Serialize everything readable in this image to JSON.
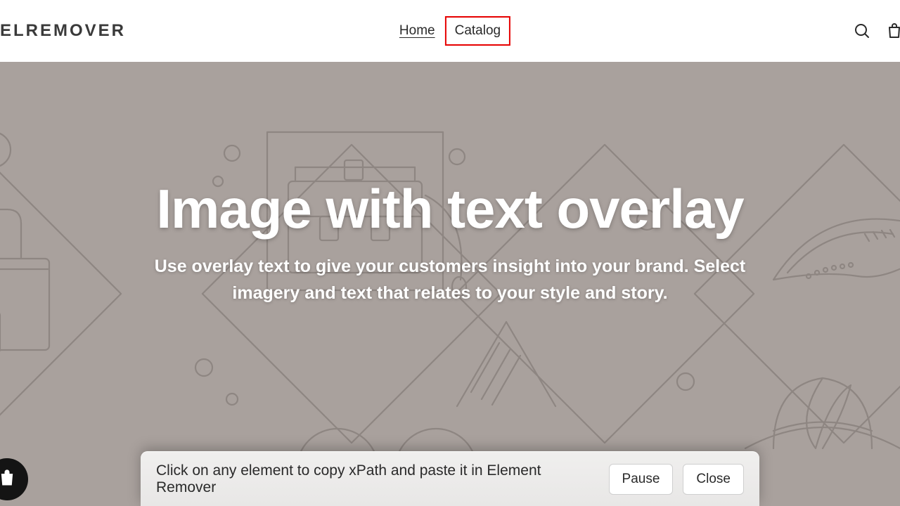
{
  "header": {
    "logo": "ELREMOVER",
    "nav": {
      "home": "Home",
      "catalog": "Catalog"
    },
    "icons": {
      "search": "search-icon",
      "cart": "cart-icon"
    }
  },
  "hero": {
    "title": "Image with text overlay",
    "subtitle": "Use overlay text to give your customers insight into your brand. Select imagery and text that relates to your style and story."
  },
  "toolbar": {
    "message": "Click on any element to copy xPath and paste it in Element Remover",
    "pause_label": "Pause",
    "close_label": "Close"
  },
  "badge": {
    "icon": "store-bag-icon"
  },
  "highlight": {
    "target": "nav.catalog",
    "color": "#e60000"
  }
}
